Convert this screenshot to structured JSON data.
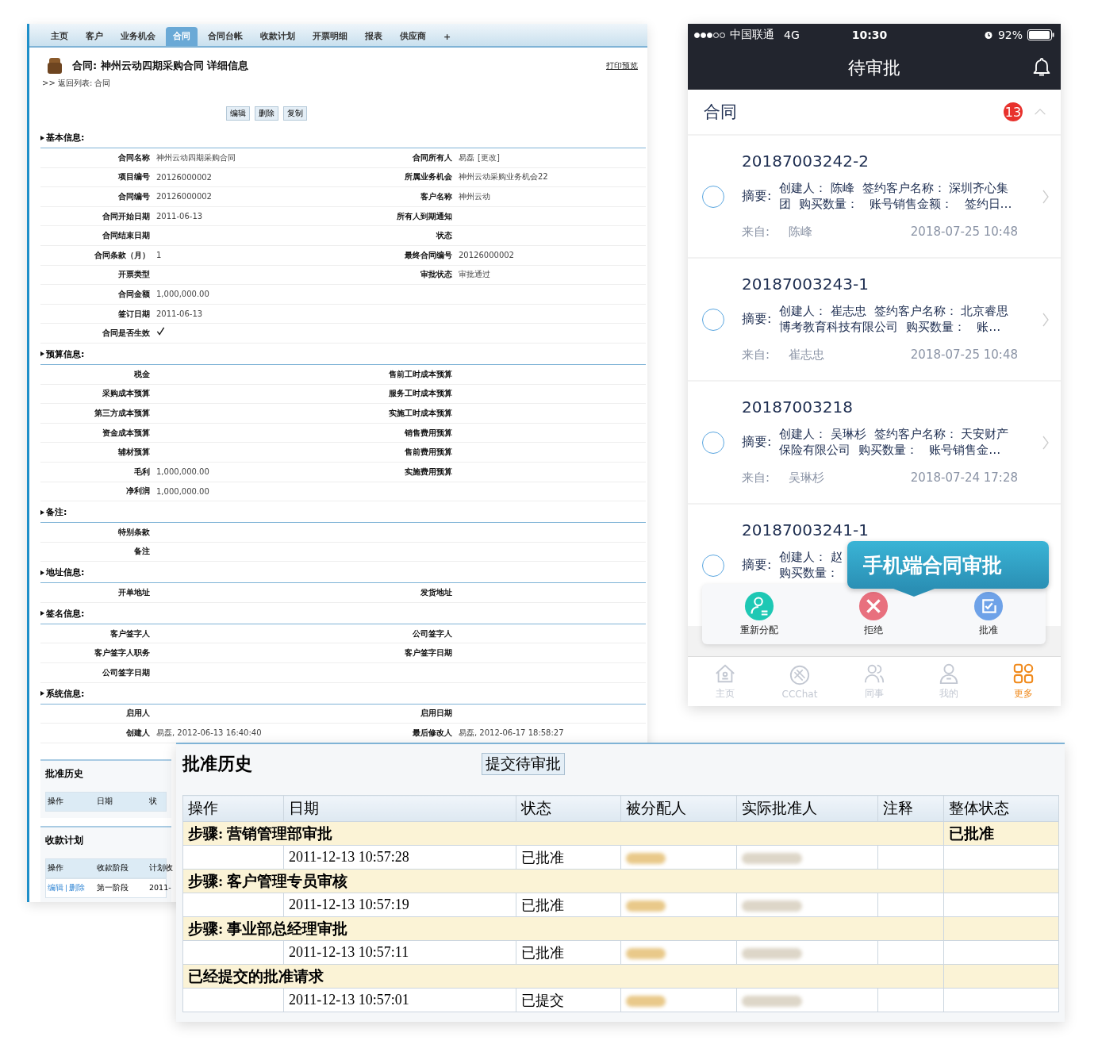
{
  "crm": {
    "nav": [
      {
        "label": "主页",
        "selected": false
      },
      {
        "label": "客户",
        "selected": false
      },
      {
        "label": "业务机会",
        "selected": false
      },
      {
        "label": "合同",
        "selected": true
      },
      {
        "label": "合同台帐",
        "selected": false
      },
      {
        "label": "收款计划",
        "selected": false
      },
      {
        "label": "开票明细",
        "selected": false
      },
      {
        "label": "报表",
        "selected": false
      },
      {
        "label": "供应商",
        "selected": false
      },
      {
        "label": "+",
        "selected": false
      }
    ],
    "title": "合同: 神州云动四期采购合同 详细信息",
    "breadcrumb": ">> 返回列表: 合同",
    "print_link": "打印预览",
    "buttons": [
      "编辑",
      "删除",
      "复制"
    ],
    "sections": [
      {
        "title": "基本信息:",
        "rows": [
          {
            "label_1": "合同名称",
            "value_1": "神州云动四期采购合同",
            "label_2": "合同所有人",
            "value_2": "易磊",
            "action_2": "[更改]"
          },
          {
            "label_1": "项目编号",
            "value_1": "20126000002",
            "label_2": "所属业务机会",
            "value_2": "神州云动采购业务机会22"
          },
          {
            "label_1": "合同编号",
            "value_1": "20126000002",
            "label_2": "客户名称",
            "value_2": "神州云动"
          },
          {
            "label_1": "合同开始日期",
            "value_1": "2011-06-13",
            "label_2": "所有人到期通知"
          },
          {
            "label_1": "合同结束日期",
            "label_2": "状态"
          },
          {
            "label_1": "合同条款（月）",
            "value_1": "1",
            "label_2": "最终合同编号",
            "value_2": "20126000002"
          },
          {
            "label_1": "开票类型",
            "label_2": "审批状态",
            "value_2": "审批通过"
          },
          {
            "label_1": "合同金额",
            "value_1": "1,000,000.00"
          },
          {
            "label_1": "签订日期",
            "value_1": "2011-06-13"
          },
          {
            "label_1": "合同是否生效",
            "checked": true
          }
        ]
      },
      {
        "title": "预算信息:",
        "rows": [
          {
            "label_1": "税金",
            "label_2": "售前工时成本预算"
          },
          {
            "label_1": "采购成本预算",
            "label_2": "服务工时成本预算"
          },
          {
            "label_1": "第三方成本预算",
            "label_2": "实施工时成本预算"
          },
          {
            "label_1": "资金成本预算",
            "label_2": "销售费用预算"
          },
          {
            "label_1": "辅材预算",
            "label_2": "售前费用预算"
          },
          {
            "label_1": "毛利",
            "value_1": "1,000,000.00",
            "label_2": "实施费用预算"
          },
          {
            "label_1": "净利润",
            "value_1": "1,000,000.00"
          }
        ]
      },
      {
        "title": "备注:",
        "rows": [
          {
            "label_1": "特别条款"
          },
          {
            "label_1": "备注"
          }
        ]
      },
      {
        "title": "地址信息:",
        "rows": [
          {
            "label_1": "开单地址",
            "label_2": "发货地址"
          }
        ]
      },
      {
        "title": "签名信息:",
        "rows": [
          {
            "label_1": "客户签字人",
            "label_2": "公司签字人"
          },
          {
            "label_1": "客户签字人职务",
            "label_2": "客户签字日期"
          },
          {
            "label_1": "公司签字日期"
          }
        ]
      },
      {
        "title": "系统信息:",
        "rows": [
          {
            "label_1": "启用人",
            "label_2": "启用日期"
          },
          {
            "label_1": "创建人",
            "value_1": "易磊, 2012-06-13 16:40:40",
            "label_2": "最后修改人",
            "value_2": "易磊, 2012-06-17 18:58:27"
          }
        ]
      }
    ],
    "panels": [
      {
        "title": "批准历史",
        "columns": [
          "操作",
          "日期",
          "状"
        ]
      },
      {
        "title": "收款计划",
        "columns": [
          "操作",
          "收款阶段",
          "计划收"
        ],
        "rows": [
          {
            "cells": [
              {
                "kind": "links",
                "links": [
                  "编辑",
                  "删除"
                ],
                "separator": "|"
              },
              {
                "kind": "text",
                "text": "第一阶段"
              },
              {
                "kind": "text",
                "text": "2011-"
              }
            ]
          }
        ]
      }
    ]
  },
  "mobile": {
    "status_bar": {
      "carrier": "中国联通",
      "network": "4G",
      "time": "10:30",
      "battery": "92%"
    },
    "title": "待审批",
    "section": {
      "title": "合同",
      "badge": "13",
      "expanded": true
    },
    "items": [
      {
        "number": "20187003242-2",
        "summary_label": "摘要:",
        "summary_lines": [
          "创建人： 陈峰  签约客户名称： 深圳齐心集",
          "团  购买数量：   账号销售金额：   签约日…"
        ],
        "from_label": "来自:",
        "from": "陈峰",
        "time": "2018-07-25 10:48",
        "selected": false
      },
      {
        "number": "20187003243-1",
        "summary_label": "摘要:",
        "summary_lines": [
          "创建人： 崔志忠  签约客户名称： 北京睿思",
          "博考教育科技有限公司  购买数量：   账…"
        ],
        "from_label": "来自:",
        "from": "崔志忠",
        "time": "2018-07-25 10:48",
        "selected": false
      },
      {
        "number": "20187003218",
        "summary_label": "摘要:",
        "summary_lines": [
          "创建人： 吴琳杉  签约客户名称： 天安财产",
          "保险有限公司  购买数量：   账号销售金…"
        ],
        "from_label": "来自:",
        "from": "吴琳杉",
        "time": "2018-07-24 17:28",
        "selected": false
      },
      {
        "number": "20187003241-1",
        "summary_label": "摘要:",
        "summary_lines": [
          "创建人： 赵",
          "购买数量："
        ],
        "selected": false
      }
    ],
    "tooltip": "手机端合同审批",
    "actions": [
      {
        "kind": "reassign",
        "label": "重新分配"
      },
      {
        "kind": "reject",
        "label": "拒绝"
      },
      {
        "kind": "approve",
        "label": "批准"
      }
    ],
    "tabs": [
      {
        "kind": "home",
        "label": "主页",
        "selected": false
      },
      {
        "kind": "chat",
        "label": "CCChat",
        "selected": false
      },
      {
        "kind": "colleagues",
        "label": "同事",
        "selected": false
      },
      {
        "kind": "me",
        "label": "我的",
        "selected": false
      },
      {
        "kind": "more",
        "label": "更多",
        "selected": true
      }
    ]
  },
  "history": {
    "title": "批准历史",
    "button": "提交待审批",
    "columns": [
      "操作",
      "日期",
      "状态",
      "被分配人",
      "实际批准人",
      "注释",
      "整体状态"
    ],
    "rows": [
      {
        "kind": "step",
        "label": "步骤: 营销管理部审批",
        "overall": "已批准"
      },
      {
        "kind": "entry",
        "date": "2011-12-13 10:57:28",
        "status": "已批准",
        "assignee_redacted": true,
        "approver_redacted": true
      },
      {
        "kind": "step",
        "label": "步骤: 客户管理专员审核"
      },
      {
        "kind": "entry",
        "date": "2011-12-13 10:57:19",
        "status": "已批准",
        "assignee_redacted": true,
        "approver_redacted": true
      },
      {
        "kind": "step",
        "label": "步骤: 事业部总经理审批"
      },
      {
        "kind": "entry",
        "date": "2011-12-13 10:57:11",
        "status": "已批准",
        "assignee_redacted": true,
        "approver_redacted": true
      },
      {
        "kind": "step",
        "label": "已经提交的批准请求"
      },
      {
        "kind": "entry",
        "date": "2011-12-13 10:57:01",
        "status": "已提交",
        "assignee_redacted": true,
        "approver_redacted": true
      }
    ]
  }
}
